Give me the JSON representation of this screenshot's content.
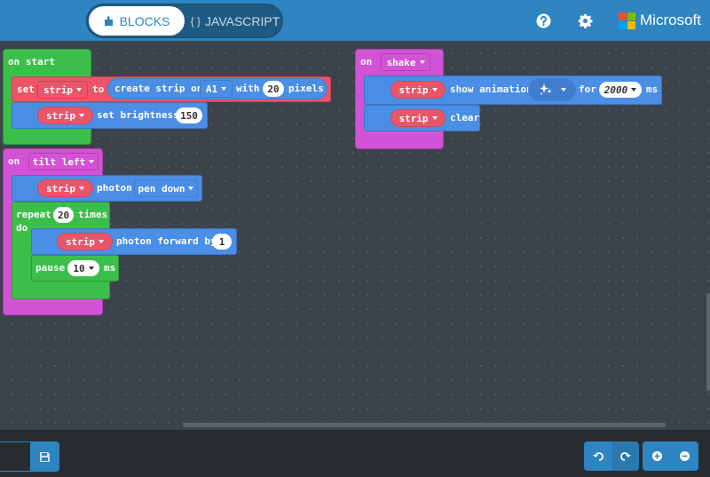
{
  "header": {
    "tabs": [
      {
        "label": "BLOCKS",
        "icon": "puzzle-icon",
        "active": true
      },
      {
        "label": "JAVASCRIPT",
        "icon": "braces-icon",
        "active": false
      }
    ],
    "braces": "{ }",
    "help_icon": "help-icon",
    "settings_icon": "gear-icon",
    "brand": "Microsoft",
    "brand_colors": [
      "#f25022",
      "#7fba00",
      "#00a4ef",
      "#ffb900"
    ]
  },
  "colors": {
    "header": "#2e85c1",
    "workspace": "#3d434a",
    "event_green": "#3cbf4a",
    "event_magenta": "#d353d6",
    "light_blue": "#4b8ee6",
    "variable_red": "#e9566a"
  },
  "blocks": {
    "on_start": {
      "label": "on start",
      "set_block": {
        "set": "set",
        "variable": "strip",
        "to": "to",
        "create": "create strip on",
        "pin": "A1",
        "with": "with",
        "pixels_value": "20",
        "pixels": "pixels"
      },
      "brightness_block": {
        "variable": "strip",
        "action": "set brightness",
        "value": "150"
      }
    },
    "on_tilt": {
      "on": "on",
      "event": "tilt left",
      "photon_block": {
        "variable": "strip",
        "action": "photon",
        "mode": "pen down"
      },
      "repeat_block": {
        "repeat": "repeat",
        "count": "20",
        "times": "times",
        "do": "do",
        "forward_block": {
          "variable": "strip",
          "action": "photon forward by",
          "value": "1"
        },
        "pause_block": {
          "pause": "pause",
          "value": "10",
          "unit": "ms"
        }
      }
    },
    "on_shake": {
      "on": "on",
      "event": "shake",
      "animation_block": {
        "variable": "strip",
        "action": "show animation",
        "animation_icon": "sparkle-icon",
        "for": "for",
        "duration": "2000",
        "unit": "ms"
      },
      "clear_block": {
        "variable": "strip",
        "action": "clear"
      }
    }
  },
  "bottom": {
    "project_name": "",
    "save_icon": "save-icon",
    "undo_icon": "undo-icon",
    "redo_icon": "redo-icon",
    "zoom_in_icon": "zoom-in-icon",
    "zoom_out_icon": "zoom-out-icon"
  }
}
